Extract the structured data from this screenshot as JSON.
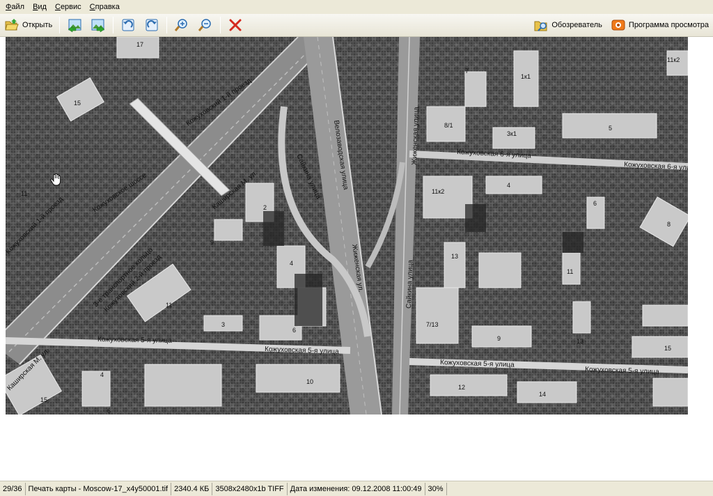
{
  "menu": {
    "file": "Файл",
    "view": "Вид",
    "service": "Сервис",
    "help": "Справка"
  },
  "toolbar": {
    "open_label": "Открыть",
    "explorer_label": "Обозреватель",
    "viewer_label": "Программа просмотра"
  },
  "map": {
    "labels": [
      "Кожуховский 1-й проезд",
      "Кожуховское шоссе",
      "Каширская М. ул.",
      "3-е транспортное кольцо",
      "Кожуховский 2-й проезд",
      "Велозаводская улица",
      "Сайкина улица",
      "Жиженская ул.",
      "Жиженская улица",
      "Сайкина улица",
      "Кожуховская 6-я улица",
      "Кожуховская 6-я улица",
      "Кожуховская 5-я улица",
      "Кожуховская 5-я улица",
      "Кожуховская 5-я улица",
      "Кожуховская 5-я улица",
      "Каширская М. ул.",
      "Кожуховский 1-й проезд"
    ],
    "house_numbers": [
      "17",
      "15",
      "11",
      "2",
      "9",
      "4",
      "11",
      "3",
      "6",
      "4",
      "10",
      "15",
      "6",
      "7",
      "1к1",
      "8/1",
      "3к1",
      "5",
      "11к2",
      "4",
      "6",
      "8",
      "13",
      "11",
      "7/13",
      "9",
      "13",
      "15",
      "12",
      "14",
      "11к2"
    ]
  },
  "status": {
    "page": "29/36",
    "file": "Печать карты - Moscow-17_x4y50001.tif",
    "size": "2340.4 КБ",
    "format": "3508x2480x1b TIFF",
    "modified": "Дата изменения: 09.12.2008 11:00:49",
    "zoom": "30%"
  },
  "colors": {
    "chrome": "#ece9d8",
    "accent": "#3a6fc4",
    "delete": "#d42a1e"
  }
}
